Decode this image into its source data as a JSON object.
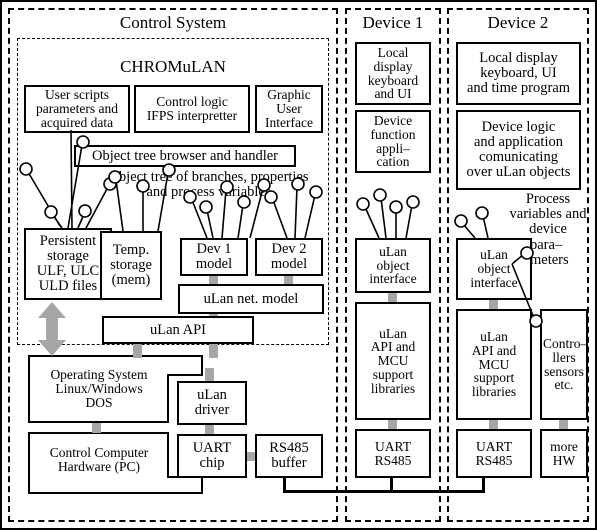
{
  "diagram": {
    "columns": [
      {
        "title": "Control System"
      },
      {
        "title": "Device 1"
      },
      {
        "title": "Device 2"
      }
    ],
    "control_system": {
      "app_title": "CHROMuLAN",
      "boxes": {
        "user_scripts": "User scripts\nparameters and\nacquired data",
        "control_logic": "Control logic\nIFPS interpretter",
        "gui": "Graphic\nUser\nInterface",
        "object_tree_browser": "Object tree browser and handler",
        "persistent_storage": "Persistent\nstorage\nULF, ULC\nULD files",
        "temp_storage": "Temp.\nstorage\n(mem)",
        "dev1_model": "Dev 1\nmodel",
        "dev2_model": "Dev 2\nmodel",
        "ulan_net_model": "uLan net. model",
        "ulan_api": "uLan API",
        "operating_system": "Operating System\nLinux/Windows\nDOS",
        "ulan_driver": "uLan\ndriver",
        "control_computer": "Control Computer\nHardware (PC)",
        "uart_chip": "UART\nchip",
        "rs485_buffer": "RS485\nbuffer"
      },
      "labels": {
        "object_tree": "Object tree of branches, properties\nand process variables"
      }
    },
    "device1": {
      "boxes": {
        "local_display": "Local\ndisplay\nkeyboard\nand UI",
        "device_function": "Device\nfunction\nappli–\ncation",
        "ulan_object_interface": "uLan\nobject\ninterface",
        "ulan_api_mcu": "uLan\nAPI and\nMCU\nsupport\nlibraries",
        "uart_rs485": "UART\nRS485"
      }
    },
    "device2": {
      "boxes": {
        "local_display": "Local display\nkeyboard, UI\nand time program",
        "device_logic": "Device logic\nand application\ncomunicating\nover uLan objects",
        "ulan_object_interface": "uLan\nobject\ninterface",
        "ulan_api_mcu": "uLan\nAPI and\nMCU\nsupport\nlibraries",
        "uart_rs485": "UART\nRS485",
        "controllers": "Contro–\nllers\nsensors\netc.",
        "more_hw": "more\nHW"
      },
      "labels": {
        "process_vars": "Process\nvariables and\ndevice",
        "parameters": "para–\nmeters"
      }
    },
    "colors": {
      "line": "#000000",
      "stud": "#a6a6a6",
      "background": "#ffffff"
    }
  }
}
